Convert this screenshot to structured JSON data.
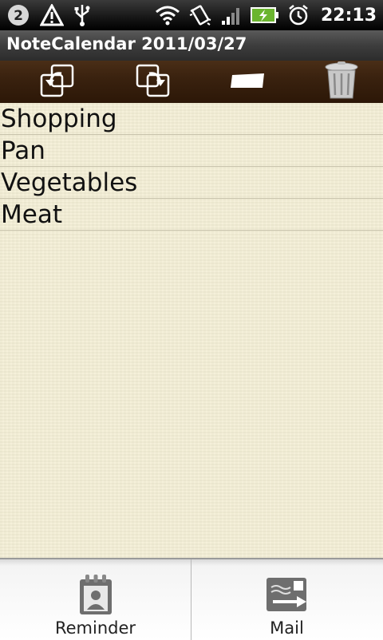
{
  "status_bar": {
    "time": "22:13"
  },
  "app": {
    "title": "NoteCalendar 2011/03/27"
  },
  "toolbar": {
    "buttons": [
      {
        "icon": "undo-icon"
      },
      {
        "icon": "redo-icon"
      },
      {
        "icon": "eraser-icon"
      },
      {
        "icon": "trash-icon"
      }
    ]
  },
  "note": {
    "lines": [
      "Shopping",
      "Pan",
      "Vegetables",
      "Meat"
    ]
  },
  "menu": {
    "items": [
      {
        "label": "Reminder",
        "icon": "reminder-calendar-icon"
      },
      {
        "label": "Mail",
        "icon": "mail-icon"
      }
    ]
  }
}
